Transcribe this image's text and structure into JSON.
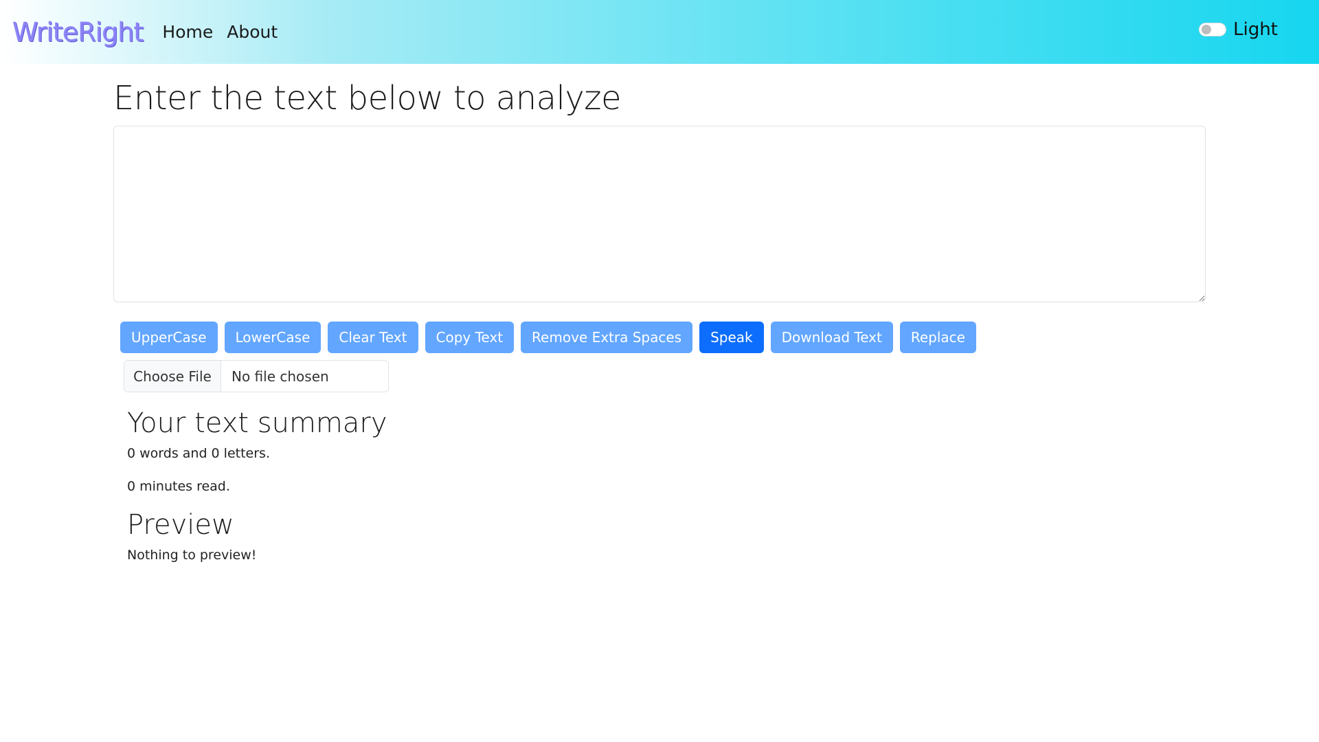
{
  "navbar": {
    "brand": "WriteRight",
    "links": [
      "Home",
      "About"
    ],
    "toggle_label": "Light"
  },
  "main": {
    "title": "Enter the text below to analyze",
    "textarea_value": "",
    "buttons": [
      "UpperCase",
      "LowerCase",
      "Clear Text",
      "Copy Text",
      "Remove Extra Spaces",
      "Speak",
      "Download Text",
      "Replace"
    ],
    "file_input": {
      "button": "Choose File",
      "status": "No file chosen"
    }
  },
  "summary": {
    "heading": "Your text summary",
    "words_line": "0 words and 0 letters.",
    "minutes_line": "0 minutes read."
  },
  "preview": {
    "heading": "Preview",
    "text": "Nothing to preview!"
  },
  "colors": {
    "brand": "#8c84f5",
    "button": "#62a6ff",
    "button_primary": "#0d6efd",
    "navbar_end": "#16d6ef"
  }
}
